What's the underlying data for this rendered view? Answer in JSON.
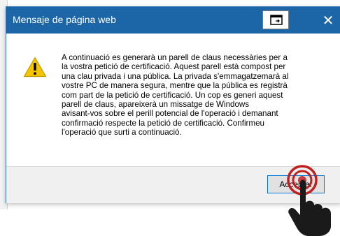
{
  "dialog": {
    "title": "Mensaje de página web",
    "close_symbol": "✕",
    "message": "A continuació es generarà un parell de claus necessàries per a\nla vostra petició de certificació. Aquest parell està compost per\nuna clau privada i una pública. La privada s'emmagatzemarà al\nvostre PC de manera segura, mentre que la pública es registrà\ncom part de la petició de certificació. Un cop es generi aquest\nparell de claus, apareixerà un missatge de Windows\navisant-vos sobre el perill potencial de l'operació i demanant\nconfirmació respecte la petició de certificació. Confirmeu\nl'operació que surti a continuació.",
    "accept_label": "Acceptar",
    "icons": {
      "warning": "warning-icon",
      "restore": "restore-window-icon",
      "close": "close-icon",
      "pointer": "hand-pointer-icon"
    },
    "colors": {
      "titlebar": "#1c66a8",
      "warning": "#f5c400",
      "button_border": "#0078d7",
      "click_marker": "#c0201f"
    }
  }
}
